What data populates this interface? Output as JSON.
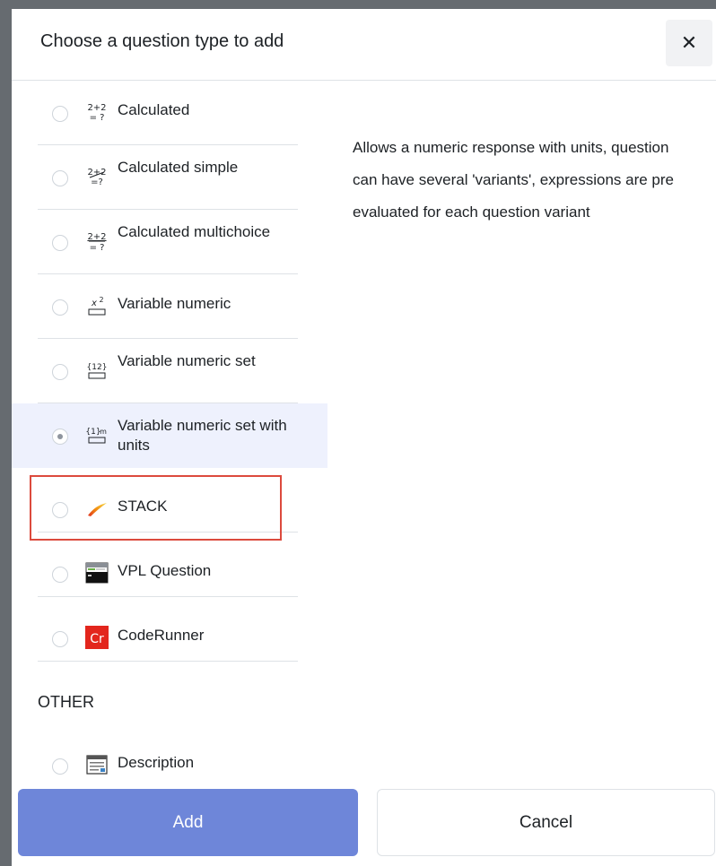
{
  "dialog": {
    "title": "Choose a question type to add",
    "close_glyph": "✕"
  },
  "question_types": [
    {
      "label": "Calculated",
      "icon": "calculated-icon",
      "selected": false
    },
    {
      "label": "Calculated simple",
      "icon": "calculated-simple-icon",
      "selected": false
    },
    {
      "label": "Calculated multichoice",
      "icon": "calculated-multichoice-icon",
      "selected": false
    },
    {
      "label": "Variable numeric",
      "icon": "variable-numeric-icon",
      "selected": false
    },
    {
      "label": "Variable numeric set",
      "icon": "variable-numeric-set-icon",
      "selected": false
    },
    {
      "label": "Variable numeric set with units",
      "icon": "variable-numeric-set-units-icon",
      "selected": true
    },
    {
      "label": "STACK",
      "icon": "stack-icon",
      "selected": false
    },
    {
      "label": "VPL Question",
      "icon": "vpl-icon",
      "selected": false
    },
    {
      "label": "CodeRunner",
      "icon": "coderunner-icon",
      "selected": false
    }
  ],
  "other_section": {
    "heading": "OTHER",
    "items": [
      {
        "label": "Description",
        "icon": "description-icon",
        "selected": false
      }
    ]
  },
  "description_text": "Allows a numeric response with units, question can have several 'variants', expressions are pre evaluated for each question variant",
  "buttons": {
    "add": "Add",
    "cancel": "Cancel"
  },
  "colors": {
    "add_button": "#6e86d9",
    "selected_row": "#eef1fd",
    "highlight_border": "#dc4a3d",
    "frame": "#666b70"
  }
}
